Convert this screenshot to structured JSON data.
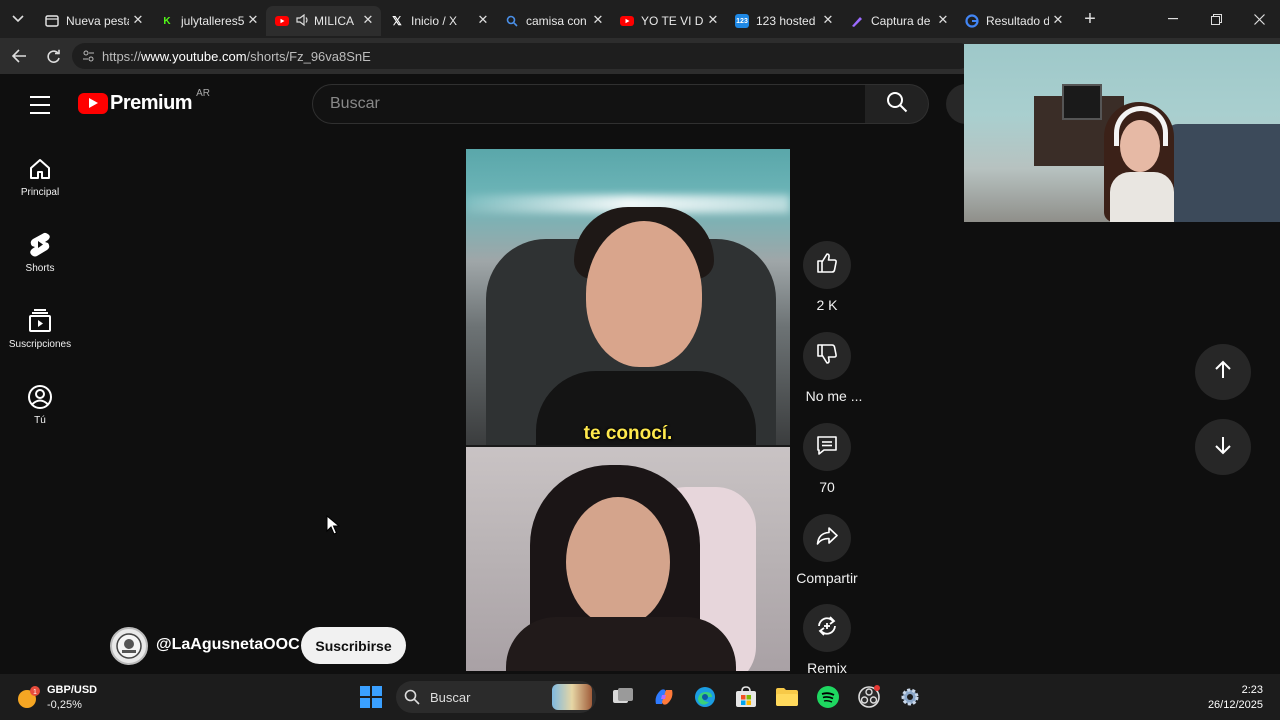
{
  "browser": {
    "tabs": [
      {
        "title": "Nueva pesta",
        "favicon": "newtab-icon",
        "color": "#e8e8e8"
      },
      {
        "title": "julytalleres5",
        "favicon": "kick-icon",
        "color": "#53fc18"
      },
      {
        "title": "MILICA",
        "favicon": "youtube-icon",
        "color": "#ff0000",
        "active": true,
        "muted_icon": "speaker-icon"
      },
      {
        "title": "Inicio / X",
        "favicon": "x-icon",
        "color": "#ffffff"
      },
      {
        "title": "camisa con",
        "favicon": "search-icon",
        "color": "#4a8fe7"
      },
      {
        "title": "YO TE VI DE",
        "favicon": "youtube-icon",
        "color": "#ff0000"
      },
      {
        "title": "123 hosted",
        "favicon": "123-icon",
        "color": "#1e88e5"
      },
      {
        "title": "Captura de",
        "favicon": "pen-icon",
        "color": "#9c6bff"
      },
      {
        "title": "Resultado d",
        "favicon": "google-icon",
        "color": "#4285f4"
      }
    ],
    "url_prefix": "https://",
    "url_host": "www.youtube.com",
    "url_path": "/shorts/Fz_96va8SnE"
  },
  "youtube": {
    "logo_word": "Premium",
    "country": "AR",
    "search_placeholder": "Buscar",
    "guide": [
      {
        "label": "Principal",
        "icon": "home-icon"
      },
      {
        "label": "Shorts",
        "icon": "shorts-icon"
      },
      {
        "label": "Suscripciones",
        "icon": "subscriptions-icon"
      },
      {
        "label": "Tú",
        "icon": "user-icon"
      }
    ],
    "short": {
      "caption": "te conocí.",
      "channel_handle": "@LaAgusnetaOOC",
      "subscribe_label": "Suscribirse"
    },
    "actions": {
      "like_count": "2 K",
      "dislike_label": "No me ...",
      "comments_count": "70",
      "share_label": "Compartir",
      "remix_label": "Remix"
    }
  },
  "taskbar": {
    "ticker_name": "GBP/USD",
    "ticker_change": "-0,25%",
    "search_placeholder": "Buscar",
    "time": "2:23",
    "date": "26/12/2025"
  }
}
